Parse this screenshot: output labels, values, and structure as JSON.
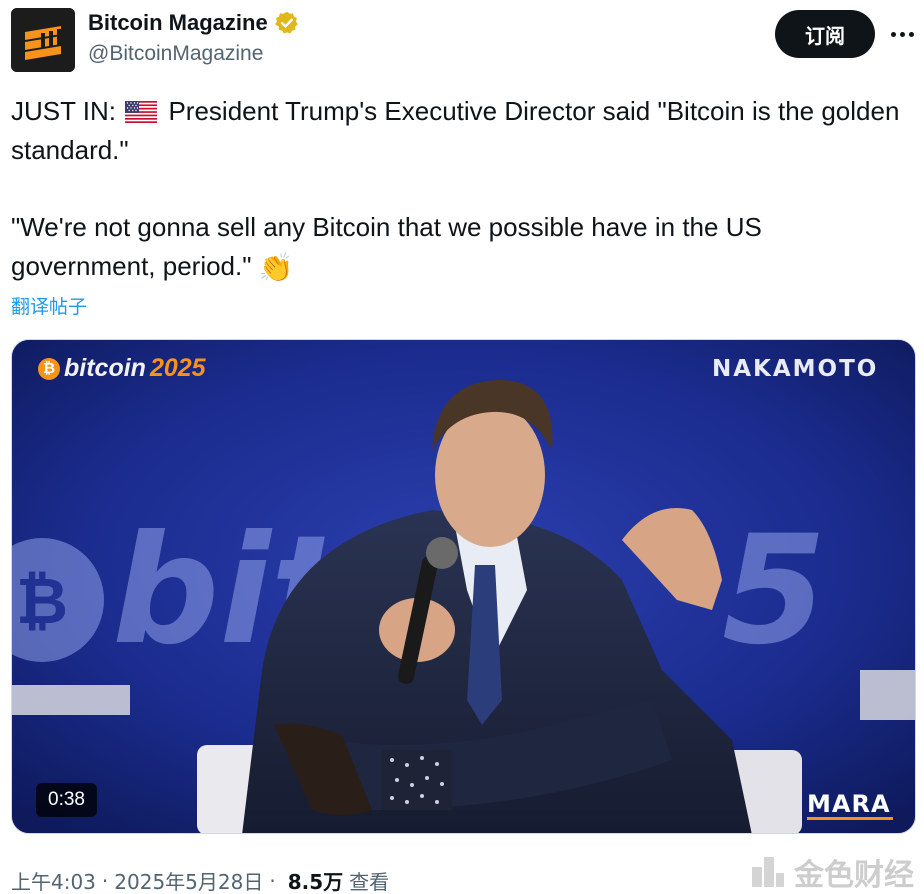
{
  "author": {
    "display_name": "Bitcoin Magazine",
    "handle": "@BitcoinMagazine",
    "verified_icon": "verified-gold-badge-icon"
  },
  "actions": {
    "subscribe_label": "订阅",
    "more_icon": "more-horizontal-icon"
  },
  "tweet": {
    "line1_prefix": "JUST IN:",
    "line1_flag": "us-flag-icon",
    "line1_text": "President Trump's Executive Director said \"Bitcoin is the golden standard.\"",
    "line2_text": "\"We're not gonna sell any Bitcoin that we possible have in the US government, period.\"",
    "line2_emoji": "👏",
    "translate_label": "翻译帖子"
  },
  "video": {
    "brand_left_word": "bitcoin",
    "brand_left_year": "2025",
    "brand_left_coin": "₿",
    "brand_right": "NAKAMOTO",
    "sponsor": "MARA",
    "duration": "0:38"
  },
  "footer": {
    "time": "上午4:03",
    "date": "2025年5月28日",
    "separator": "·",
    "views_count": "8.5万",
    "views_label": "查看"
  },
  "watermark": {
    "text": "金色财经"
  },
  "colors": {
    "accent": "#1d9bf0",
    "text": "#0f1419",
    "muted": "#536471",
    "bitcoin_orange": "#f7931a",
    "stage_blue": "#1b2c8f"
  }
}
